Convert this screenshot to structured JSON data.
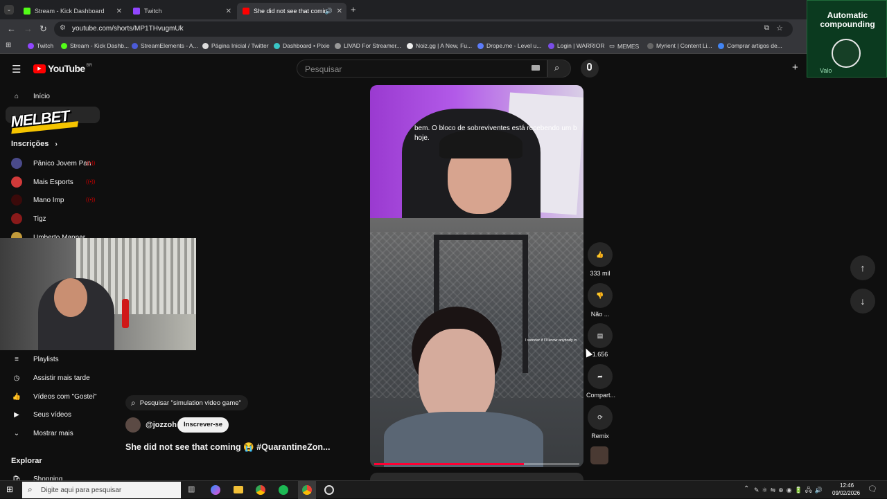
{
  "browser": {
    "tabs": [
      {
        "label": "Stream - Kick Dashboard",
        "color": "#53fc18"
      },
      {
        "label": "Twitch",
        "color": "#9146ff"
      },
      {
        "label": "She did not see that coming",
        "color": "#ff0000"
      }
    ],
    "new_tab": "+",
    "url": "youtube.com/shorts/MP1THvugmUk",
    "bookmarks": [
      "Twitch",
      "Stream - Kick Dashb...",
      "StreamElements - A...",
      "Página Inicial / Twitter",
      "Dashboard • Pixie",
      "LIVAD For Streamer...",
      "Noiz.gg | A New, Fu...",
      "Drope.me - Level u...",
      "Login | WARRIOR",
      "MEMES",
      "Myrient | Content Li...",
      "Comprar artigos de..."
    ]
  },
  "youtube": {
    "logo": "YouTube",
    "region": "BR",
    "search_placeholder": "Pesquisar",
    "sidebar": {
      "home": "Início",
      "subscriptions_header": "Inscrições",
      "subscriptions": [
        "Pânico Jovem Pan",
        "Mais Esports",
        "Mano Imp",
        "Tigz",
        "Umberto Mannar"
      ],
      "items": [
        "Playlists",
        "Assistir mais tarde",
        "Vídeos com \"Gostei\"",
        "Seus vídeos",
        "Mostrar mais"
      ],
      "explore": "Explorar",
      "shopping": "Shopping"
    },
    "short": {
      "search_chip": "Pesquisar \"simulation video game\"",
      "channel": "@jozzoh",
      "subscribe": "Inscrever-se",
      "title": "She did not see that coming 😭 #QuarantineZon...",
      "subtitle_text": "bem.  O bloco de sobreviventes está recebendo um b hoje.",
      "game_caption": "I wonder if I'll know anybody in",
      "likes": "333 mil",
      "dislike": "Não ...",
      "comments": "1.656",
      "share": "Compart...",
      "remix": "Remix",
      "progress": 0.73
    }
  },
  "overlay": {
    "sponsor": "MELBET",
    "promo_title": "Automatic compounding",
    "promo_brand": "Valo"
  },
  "taskbar": {
    "search": "Digite aqui para pesquisar",
    "time": "12:46",
    "date": "09/02/2026"
  }
}
